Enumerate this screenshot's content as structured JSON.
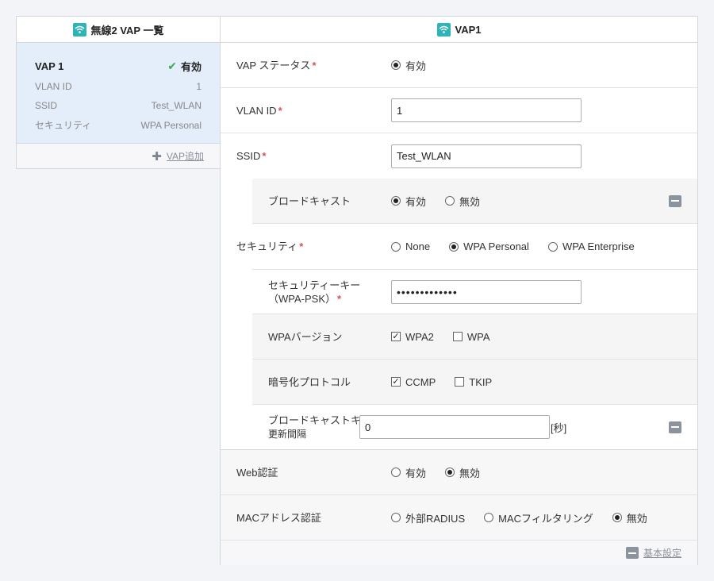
{
  "left": {
    "title": "無線2  VAP 一覧",
    "card": {
      "name": "VAP 1",
      "status": "有効",
      "rows": [
        {
          "key": "VLAN ID",
          "value": "1"
        },
        {
          "key": "SSID",
          "value": "Test_WLAN"
        },
        {
          "key": "セキュリティ",
          "value": "WPA Personal"
        }
      ]
    },
    "add_label": "VAP追加"
  },
  "right": {
    "title": "VAP1",
    "vap_status": {
      "label": "VAP ステータス",
      "option": "有効"
    },
    "vlan_id": {
      "label": "VLAN ID",
      "value": "1"
    },
    "ssid": {
      "label": "SSID",
      "value": "Test_WLAN"
    },
    "broadcast": {
      "label": "ブロードキャスト",
      "options": [
        "有効",
        "無効"
      ],
      "selected": 0
    },
    "security": {
      "label": "セキュリティ",
      "options": [
        "None",
        "WPA Personal",
        "WPA Enterprise"
      ],
      "selected": 1
    },
    "security_key": {
      "label_line1": "セキュリティーキー",
      "label_line2": "（WPA-PSK）",
      "value": "•••••••••••••"
    },
    "wpa_version": {
      "label": "WPAバージョン",
      "options": [
        "WPA2",
        "WPA"
      ],
      "checked": [
        true,
        false
      ]
    },
    "cipher": {
      "label": "暗号化プロトコル",
      "options": [
        "CCMP",
        "TKIP"
      ],
      "checked": [
        true,
        false
      ]
    },
    "bcast_key": {
      "label_line1": "ブロードキャストキー",
      "label_line2": "更新間隔",
      "value": "0",
      "unit": "[秒]"
    },
    "web_auth": {
      "label": "Web認証",
      "options": [
        "有効",
        "無効"
      ],
      "selected": 1
    },
    "mac_auth": {
      "label": "MACアドレス認証",
      "options": [
        "外部RADIUS",
        "MACフィルタリング",
        "無効"
      ],
      "selected": 2
    },
    "footer_link": "基本設定"
  }
}
